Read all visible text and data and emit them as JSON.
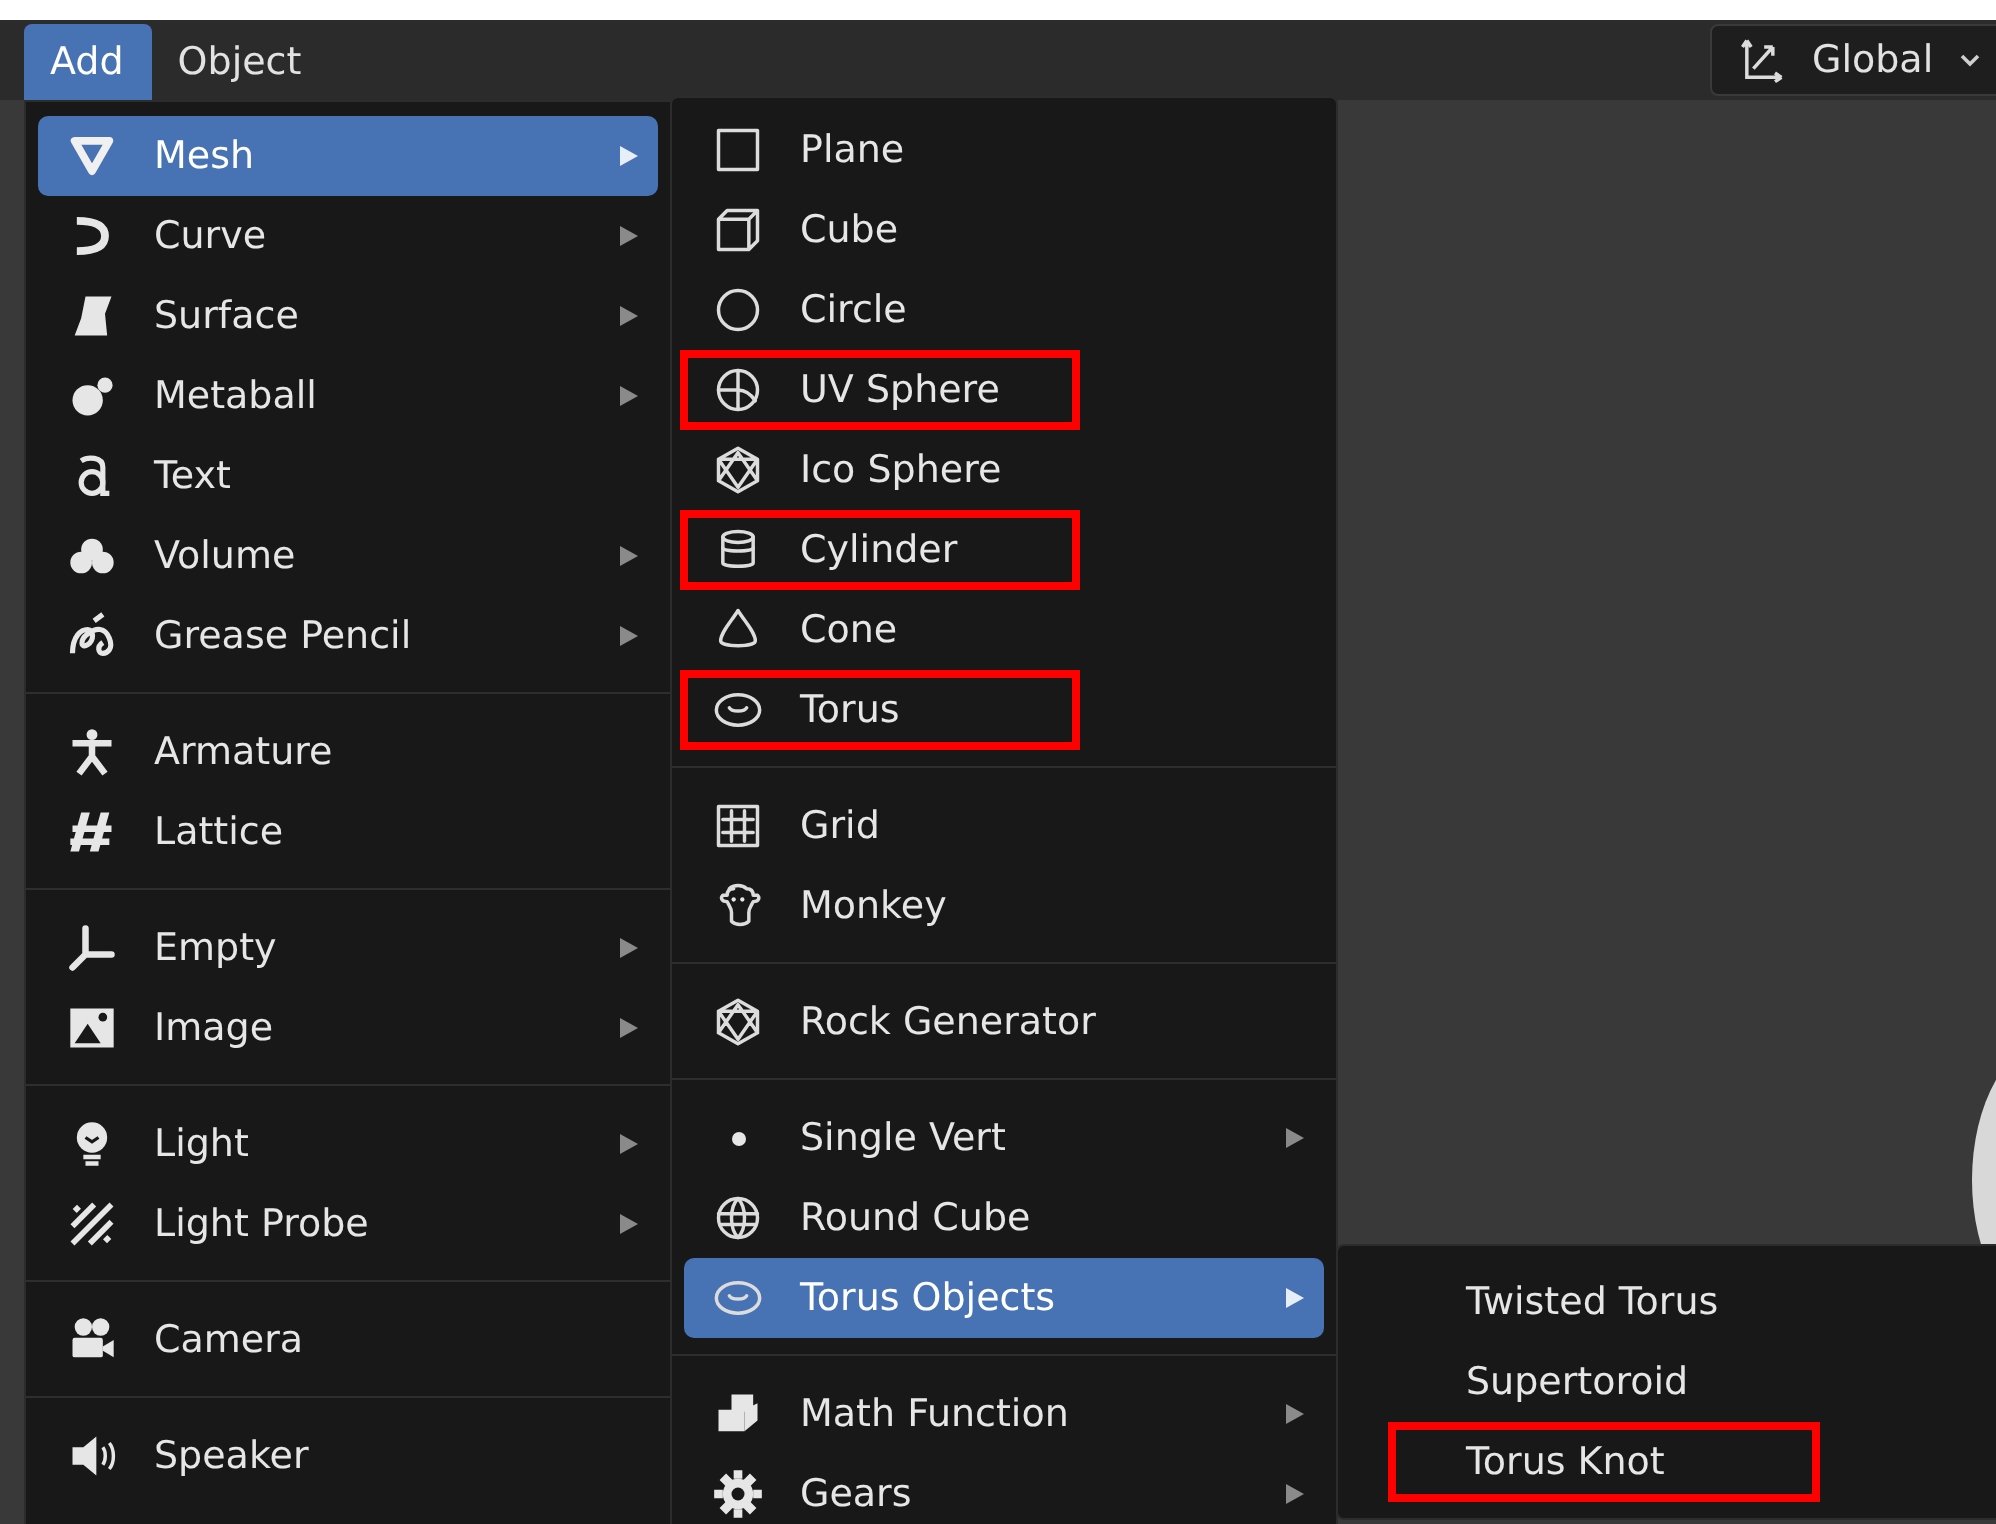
{
  "header": {
    "tabs": [
      {
        "label": "Add",
        "selected": true
      },
      {
        "label": "Object",
        "selected": false
      }
    ],
    "orientation": {
      "value": "Global"
    }
  },
  "menus": [
    {
      "groups": [
        {
          "items": [
            {
              "label": "Mesh",
              "submenu": true,
              "selected": true,
              "annotated": false
            },
            {
              "label": "Curve",
              "submenu": true,
              "selected": false,
              "annotated": false
            },
            {
              "label": "Surface",
              "submenu": true,
              "selected": false,
              "annotated": false
            },
            {
              "label": "Metaball",
              "submenu": true,
              "selected": false,
              "annotated": false
            },
            {
              "label": "Text",
              "submenu": false,
              "selected": false,
              "annotated": false
            },
            {
              "label": "Volume",
              "submenu": true,
              "selected": false,
              "annotated": false
            },
            {
              "label": "Grease Pencil",
              "submenu": true,
              "selected": false,
              "annotated": false
            }
          ]
        },
        {
          "items": [
            {
              "label": "Armature",
              "submenu": false,
              "selected": false,
              "annotated": false
            },
            {
              "label": "Lattice",
              "submenu": false,
              "selected": false,
              "annotated": false
            }
          ]
        },
        {
          "items": [
            {
              "label": "Empty",
              "submenu": true,
              "selected": false,
              "annotated": false
            },
            {
              "label": "Image",
              "submenu": true,
              "selected": false,
              "annotated": false
            }
          ]
        },
        {
          "items": [
            {
              "label": "Light",
              "submenu": true,
              "selected": false,
              "annotated": false
            },
            {
              "label": "Light Probe",
              "submenu": true,
              "selected": false,
              "annotated": false
            }
          ]
        },
        {
          "items": [
            {
              "label": "Camera",
              "submenu": false,
              "selected": false,
              "annotated": false
            }
          ]
        },
        {
          "items": [
            {
              "label": "Speaker",
              "submenu": false,
              "selected": false,
              "annotated": false
            }
          ]
        }
      ]
    },
    {
      "groups": [
        {
          "items": [
            {
              "label": "Plane",
              "submenu": false,
              "selected": false,
              "annotated": false
            },
            {
              "label": "Cube",
              "submenu": false,
              "selected": false,
              "annotated": false
            },
            {
              "label": "Circle",
              "submenu": false,
              "selected": false,
              "annotated": false
            },
            {
              "label": "UV Sphere",
              "submenu": false,
              "selected": false,
              "annotated": true
            },
            {
              "label": "Ico Sphere",
              "submenu": false,
              "selected": false,
              "annotated": false
            },
            {
              "label": "Cylinder",
              "submenu": false,
              "selected": false,
              "annotated": true
            },
            {
              "label": "Cone",
              "submenu": false,
              "selected": false,
              "annotated": false
            },
            {
              "label": "Torus",
              "submenu": false,
              "selected": false,
              "annotated": true
            }
          ]
        },
        {
          "items": [
            {
              "label": "Grid",
              "submenu": false,
              "selected": false,
              "annotated": false
            },
            {
              "label": "Monkey",
              "submenu": false,
              "selected": false,
              "annotated": false
            }
          ]
        },
        {
          "items": [
            {
              "label": "Rock Generator",
              "submenu": false,
              "selected": false,
              "annotated": false
            }
          ]
        },
        {
          "items": [
            {
              "label": "Single Vert",
              "submenu": true,
              "selected": false,
              "annotated": false
            },
            {
              "label": "Round Cube",
              "submenu": false,
              "selected": false,
              "annotated": false
            },
            {
              "label": "Torus Objects",
              "submenu": true,
              "selected": true,
              "annotated": false
            }
          ]
        },
        {
          "items": [
            {
              "label": "Math Function",
              "submenu": true,
              "selected": false,
              "annotated": false
            },
            {
              "label": "Gears",
              "submenu": true,
              "selected": false,
              "annotated": false
            }
          ]
        }
      ]
    },
    {
      "groups": [
        {
          "items": [
            {
              "label": "Twisted Torus",
              "submenu": false,
              "selected": false,
              "annotated": false
            },
            {
              "label": "Supertoroid",
              "submenu": false,
              "selected": false,
              "annotated": false
            },
            {
              "label": "Torus Knot",
              "submenu": false,
              "selected": false,
              "annotated": true
            }
          ]
        }
      ]
    }
  ]
}
